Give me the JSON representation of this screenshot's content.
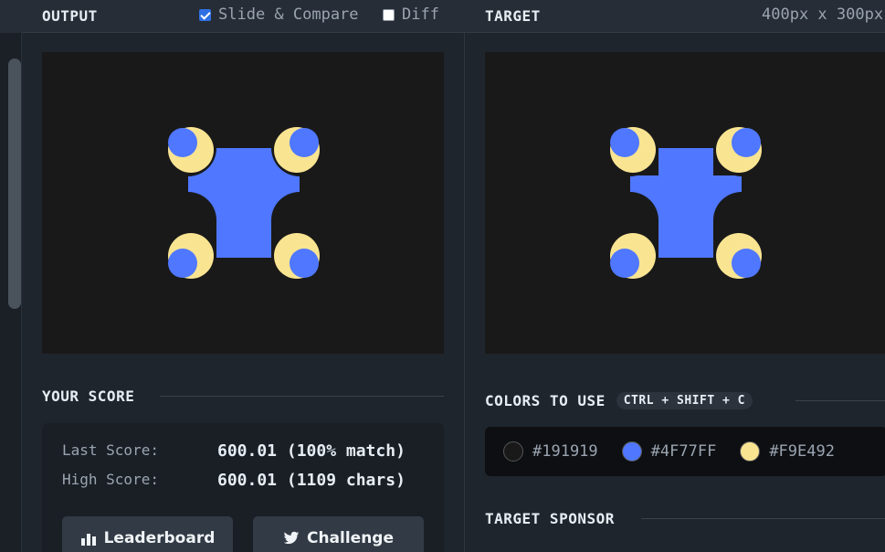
{
  "header": {
    "output_label": "OUTPUT",
    "slide_compare_label": "Slide & Compare",
    "slide_compare_checked": true,
    "diff_label": "Diff",
    "diff_checked": false,
    "target_label": "TARGET",
    "target_dims": "400px x 300px"
  },
  "score": {
    "title": "YOUR SCORE",
    "last_label": "Last Score:",
    "last_value": "600.01 (100% match)",
    "high_label": "High Score:",
    "high_value": "600.01 (1109 chars)"
  },
  "buttons": {
    "leaderboard": "Leaderboard",
    "challenge": "Challenge"
  },
  "colors_section": {
    "title": "COLORS TO USE",
    "shortcut": "CTRL + SHIFT + C",
    "colors": [
      {
        "hex": "#191919"
      },
      {
        "hex": "#4F77FF"
      },
      {
        "hex": "#F9E492"
      }
    ]
  },
  "sponsor": {
    "title": "TARGET SPONSOR"
  },
  "theme": {
    "background": "#191919",
    "blue": "#4F77FF",
    "yellow": "#F9E492"
  }
}
